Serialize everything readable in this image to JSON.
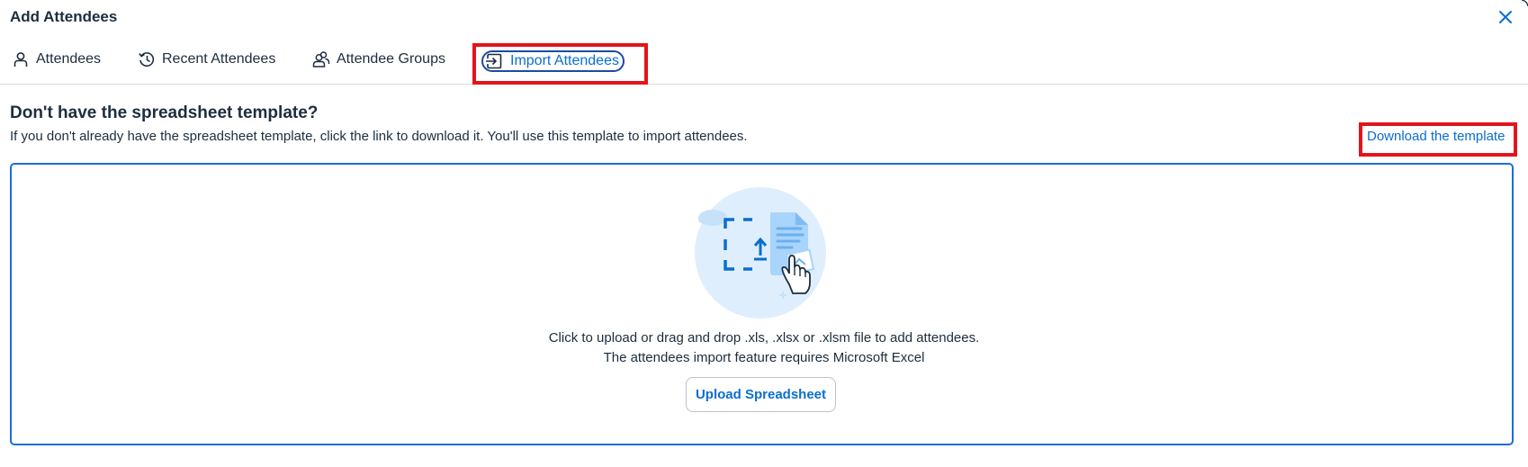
{
  "dialog": {
    "title": "Add Attendees",
    "close_icon": "close-icon"
  },
  "tabs": [
    {
      "label": "Attendees",
      "icon": "person-icon",
      "selected": false
    },
    {
      "label": "Recent Attendees",
      "icon": "history-icon",
      "selected": false
    },
    {
      "label": "Attendee Groups",
      "icon": "group-icon",
      "selected": false
    },
    {
      "label": "Import Attendees",
      "icon": "import-icon",
      "selected": true
    }
  ],
  "template_section": {
    "heading": "Don't have the spreadsheet template?",
    "description": "If you don't already have the spreadsheet template, click the link to download it. You'll use this template to import attendees.",
    "download_link": "Download the template"
  },
  "upload": {
    "illustration": "upload-illustration",
    "instruction": "Click to upload or drag and drop .xls, .xlsx or .xlsm file to add attendees.",
    "requirement": "The attendees import feature requires Microsoft Excel",
    "button_label": "Upload Spreadsheet"
  },
  "colors": {
    "link": "#0a6ed1",
    "text": "#1d2d3e",
    "highlight": "#e3141c",
    "dropzone_border": "#1a6ed8"
  }
}
